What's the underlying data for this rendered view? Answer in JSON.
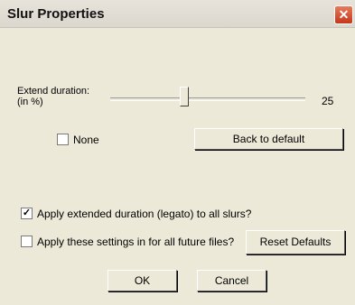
{
  "window": {
    "title": "Slur Properties",
    "close_glyph": "✕"
  },
  "extend": {
    "label_line1": "Extend duration:",
    "label_line2": "(in %)",
    "value": "25",
    "slider_fraction": 0.37
  },
  "none_checkbox": {
    "label": "None",
    "checked": false
  },
  "back_to_default_label": "Back to default",
  "apply_legato": {
    "label": "Apply extended duration (legato) to all slurs?",
    "checked": true,
    "mark": "✓"
  },
  "apply_future": {
    "label": "Apply these settings in for all future files?",
    "checked": false
  },
  "reset_defaults_label": "Reset Defaults",
  "ok_label": "OK",
  "cancel_label": "Cancel",
  "colors": {
    "dialog_bg": "#ece9d8",
    "close_button": "#c4371a"
  }
}
